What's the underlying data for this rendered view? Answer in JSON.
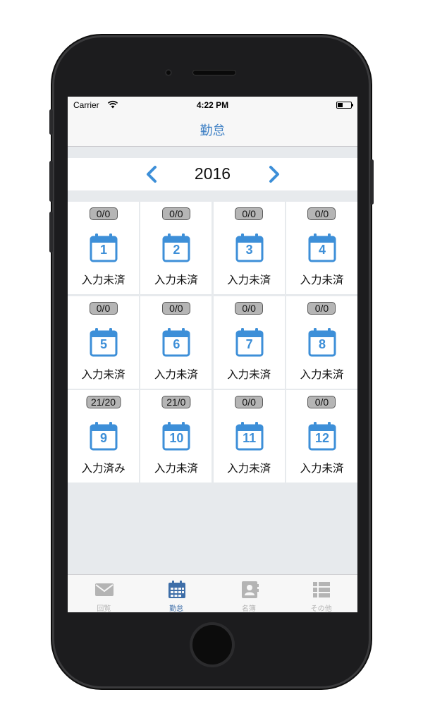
{
  "status_bar": {
    "carrier": "Carrier",
    "time": "4:22 PM"
  },
  "nav": {
    "title": "勤怠"
  },
  "year_selector": {
    "year": "2016",
    "prev_icon": "chevron-left-icon",
    "next_icon": "chevron-right-icon"
  },
  "months": [
    {
      "month": "1",
      "count": "0/0",
      "status": "入力未済"
    },
    {
      "month": "2",
      "count": "0/0",
      "status": "入力未済"
    },
    {
      "month": "3",
      "count": "0/0",
      "status": "入力未済"
    },
    {
      "month": "4",
      "count": "0/0",
      "status": "入力未済"
    },
    {
      "month": "5",
      "count": "0/0",
      "status": "入力未済"
    },
    {
      "month": "6",
      "count": "0/0",
      "status": "入力未済"
    },
    {
      "month": "7",
      "count": "0/0",
      "status": "入力未済"
    },
    {
      "month": "8",
      "count": "0/0",
      "status": "入力未済"
    },
    {
      "month": "9",
      "count": "21/20",
      "status": "入力済み"
    },
    {
      "month": "10",
      "count": "21/0",
      "status": "入力未済"
    },
    {
      "month": "11",
      "count": "0/0",
      "status": "入力未済"
    },
    {
      "month": "12",
      "count": "0/0",
      "status": "入力未済"
    }
  ],
  "tab_bar": {
    "tabs": [
      {
        "label": "回覧",
        "icon": "envelope-icon",
        "active": false
      },
      {
        "label": "勤怠",
        "icon": "calendar-icon",
        "active": true
      },
      {
        "label": "名簿",
        "icon": "address-book-icon",
        "active": false
      },
      {
        "label": "その他",
        "icon": "list-icon",
        "active": false
      }
    ]
  },
  "colors": {
    "accent": "#3d7fc4",
    "calendar": "#3d8fd8",
    "tab_active": "#3e6ea8",
    "tab_inactive": "#b4b4b4",
    "badge_bg": "#b5b5b5"
  }
}
